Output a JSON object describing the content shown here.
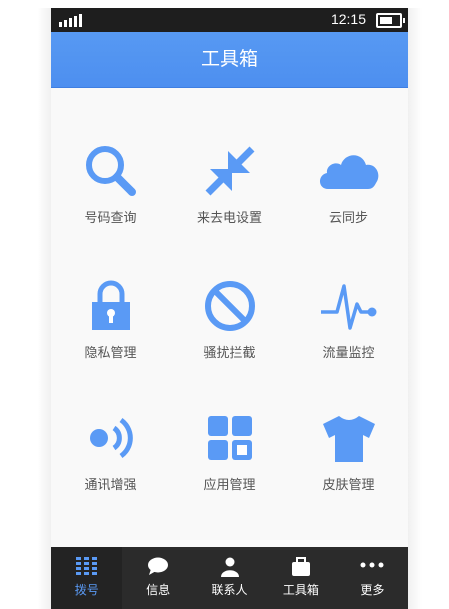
{
  "status_bar": {
    "time": "12:15",
    "signal_icon": "signal-bars-icon",
    "battery_icon": "battery-icon"
  },
  "header": {
    "title": "工具箱"
  },
  "colors": {
    "accent": "#4d8ff0",
    "icon": "#5a9af5",
    "tabbar": "#2b2b2b",
    "label": "#555555"
  },
  "tools": [
    {
      "label": "号码查询",
      "icon": "search-icon"
    },
    {
      "label": "来去电设置",
      "icon": "shrink-arrows-icon"
    },
    {
      "label": "云同步",
      "icon": "cloud-icon"
    },
    {
      "label": "隐私管理",
      "icon": "lock-icon"
    },
    {
      "label": "骚扰拦截",
      "icon": "block-icon"
    },
    {
      "label": "流量监控",
      "icon": "pulse-icon"
    },
    {
      "label": "通讯增强",
      "icon": "signal-wave-icon"
    },
    {
      "label": "应用管理",
      "icon": "apps-grid-icon"
    },
    {
      "label": "皮肤管理",
      "icon": "tshirt-icon"
    }
  ],
  "tabs": [
    {
      "label": "拨号",
      "icon": "dialpad-icon",
      "active": true
    },
    {
      "label": "信息",
      "icon": "chat-bubble-icon",
      "active": false
    },
    {
      "label": "联系人",
      "icon": "person-icon",
      "active": false
    },
    {
      "label": "工具箱",
      "icon": "toolbox-icon",
      "active": false
    },
    {
      "label": "更多",
      "icon": "more-dots-icon",
      "active": false
    }
  ]
}
